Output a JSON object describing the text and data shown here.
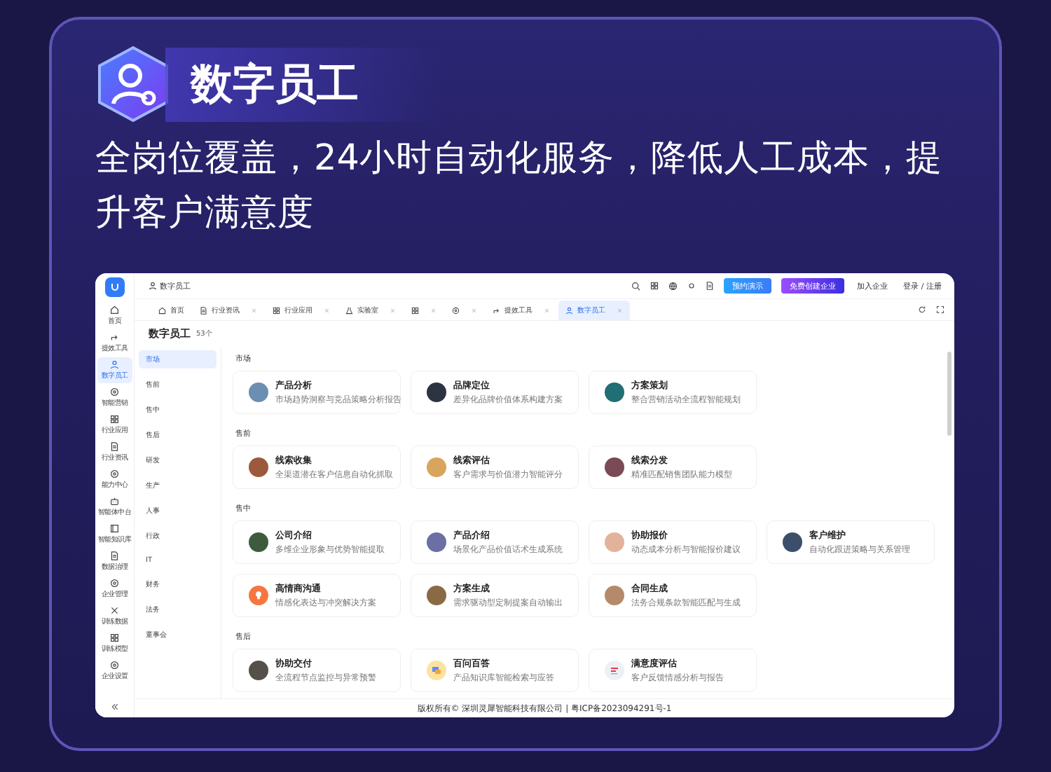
{
  "banner": {
    "title": "数字员工",
    "subtitle": "全岗位覆盖，24小时自动化服务，降低人工成本，提升客户满意度"
  },
  "app": {
    "breadcrumb": "数字员工",
    "top_actions": [
      {
        "label": "预约演示",
        "kind": "primary"
      },
      {
        "label": "免费创建企业",
        "kind": "accent"
      },
      {
        "label": "加入企业",
        "kind": "link"
      },
      {
        "label": "登录 / 注册",
        "kind": "link"
      }
    ],
    "nav": [
      {
        "label": "首页",
        "selected": false
      },
      {
        "label": "提效工具",
        "selected": false
      },
      {
        "label": "数字员工",
        "selected": true
      },
      {
        "label": "智能营销",
        "selected": false
      },
      {
        "label": "行业应用",
        "selected": false
      },
      {
        "label": "行业资讯",
        "selected": false
      },
      {
        "label": "能力中心",
        "selected": false
      },
      {
        "label": "智能体中台",
        "selected": false
      },
      {
        "label": "智能知识库",
        "selected": false
      },
      {
        "label": "数据治理",
        "selected": false
      },
      {
        "label": "企业管理",
        "selected": false
      },
      {
        "label": "训练数据",
        "selected": false
      },
      {
        "label": "训练模型",
        "selected": false
      },
      {
        "label": "企业设置",
        "selected": false
      }
    ],
    "tabs": [
      {
        "label": "首页",
        "closable": false,
        "selected": false
      },
      {
        "label": "行业资讯",
        "closable": true,
        "selected": false
      },
      {
        "label": "行业应用",
        "closable": true,
        "selected": false
      },
      {
        "label": "实验室",
        "closable": true,
        "selected": false
      },
      {
        "closable": true,
        "selected": false
      },
      {
        "closable": true,
        "selected": false
      },
      {
        "label": "提效工具",
        "closable": true,
        "selected": false
      },
      {
        "label": "数字员工",
        "closable": true,
        "selected": true
      }
    ],
    "heading": "数字员工",
    "count": "53个",
    "categories": [
      {
        "label": "市场",
        "selected": true
      },
      {
        "label": "售前",
        "selected": false
      },
      {
        "label": "售中",
        "selected": false
      },
      {
        "label": "售后",
        "selected": false
      },
      {
        "label": "研发",
        "selected": false
      },
      {
        "label": "生产",
        "selected": false
      },
      {
        "label": "人事",
        "selected": false
      },
      {
        "label": "行政",
        "selected": false
      },
      {
        "label": "IT",
        "selected": false
      },
      {
        "label": "财务",
        "selected": false
      },
      {
        "label": "法务",
        "selected": false
      },
      {
        "label": "董事会",
        "selected": false
      }
    ],
    "sections": [
      {
        "title": "市场",
        "cards": [
          {
            "title": "产品分析",
            "desc": "市场趋势洞察与竞品策略分析报告",
            "kind": "photo"
          },
          {
            "title": "品牌定位",
            "desc": "差异化品牌价值体系构建方案",
            "kind": "photo"
          },
          {
            "title": "方案策划",
            "desc": "整合营销活动全流程智能规划",
            "kind": "photo"
          }
        ]
      },
      {
        "title": "售前",
        "cards": [
          {
            "title": "线索收集",
            "desc": "全渠道潜在客户信息自动化抓取",
            "kind": "photo"
          },
          {
            "title": "线索评估",
            "desc": "客户需求与价值潜力智能评分",
            "kind": "photo"
          },
          {
            "title": "线索分发",
            "desc": "精准匹配销售团队能力模型",
            "kind": "photo"
          }
        ]
      },
      {
        "title": "售中",
        "cards": [
          {
            "title": "公司介绍",
            "desc": "多维企业形象与优势智能提取",
            "kind": "photo"
          },
          {
            "title": "产品介绍",
            "desc": "场景化产品价值话术生成系统",
            "kind": "photo"
          },
          {
            "title": "协助报价",
            "desc": "动态成本分析与智能报价建议",
            "kind": "photo"
          },
          {
            "title": "客户维护",
            "desc": "自动化跟进策略与关系管理",
            "kind": "photo"
          },
          {
            "title": "高情商沟通",
            "desc": "情感化表达与冲突解决方案",
            "kind": "icon"
          },
          {
            "title": "方案生成",
            "desc": "需求驱动型定制提案自动输出",
            "kind": "photo"
          },
          {
            "title": "合同生成",
            "desc": "法务合规条款智能匹配与生成",
            "kind": "photo"
          }
        ]
      },
      {
        "title": "售后",
        "cards": [
          {
            "title": "协助交付",
            "desc": "全流程节点监控与异常预警",
            "kind": "photo"
          },
          {
            "title": "百问百答",
            "desc": "产品知识库智能检索与应答",
            "kind": "icon"
          },
          {
            "title": "满意度评估",
            "desc": "客户反馈情感分析与报告",
            "kind": "icon"
          }
        ]
      }
    ],
    "footer": "版权所有© 深圳灵犀智能科技有限公司 | 粤ICP备2023094291号-1"
  }
}
